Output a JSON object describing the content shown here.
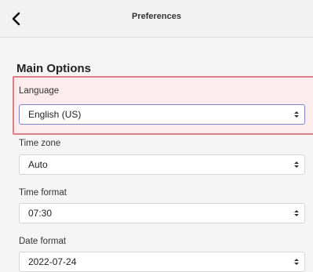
{
  "header": {
    "title": "Preferences",
    "back_icon": "chevron-left-icon"
  },
  "main": {
    "section_title": "Main Options",
    "fields": [
      {
        "label": "Language",
        "value": "English (US)"
      },
      {
        "label": "Time zone",
        "value": "Auto"
      },
      {
        "label": "Time format",
        "value": "07:30"
      },
      {
        "label": "Date format",
        "value": "2022-07-24"
      }
    ]
  },
  "colors": {
    "highlight_border": "#dc7f87",
    "focus_border": "#7a86c8"
  }
}
